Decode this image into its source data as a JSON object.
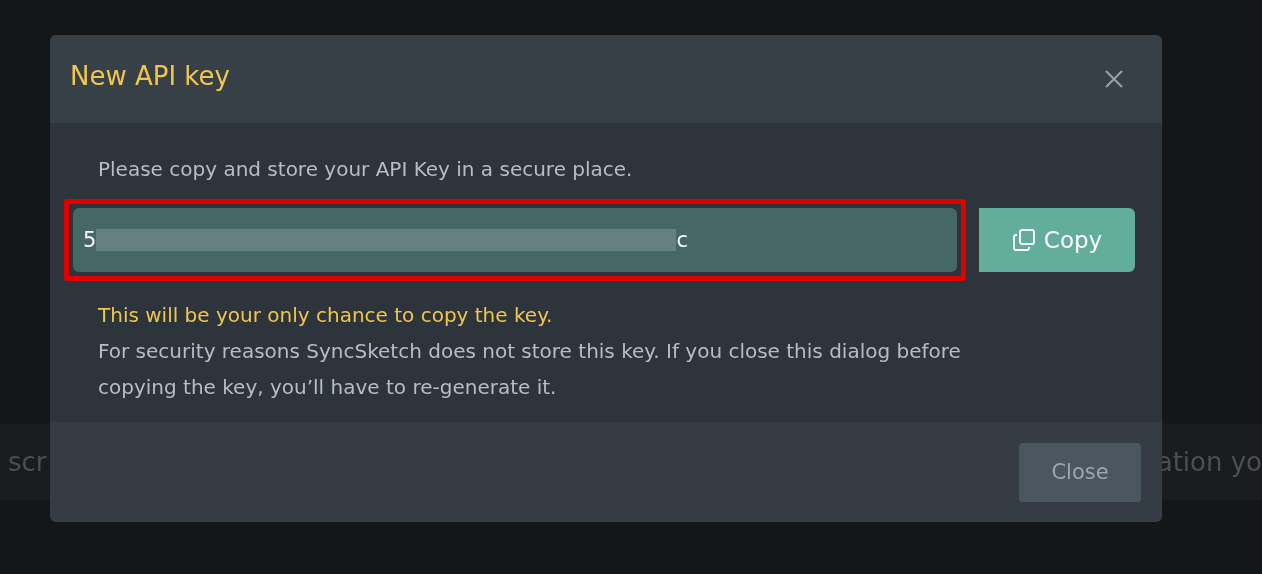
{
  "background": {
    "texts": [
      "scr",
      "ation yo"
    ]
  },
  "dialog": {
    "title": "New API key",
    "instruction": "Please copy and store your API Key in a secure place.",
    "key_field": {
      "value_start": "5",
      "value_end": "c",
      "redacted": true,
      "highlighted": true
    },
    "copy_button": "Copy",
    "warning": "This will be your only chance to copy the key.",
    "note": "For security reasons SyncSketch does not store this key. If you close this dialog before copying the key, you’ll have to re-generate it.",
    "close_button": "Close"
  }
}
